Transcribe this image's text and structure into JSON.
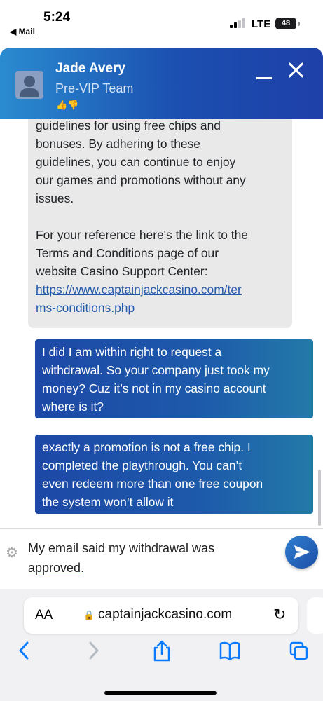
{
  "status_bar": {
    "time": "5:24",
    "back_label": "◀ Mail",
    "network": "LTE",
    "battery": "48"
  },
  "chat_header": {
    "agent_name": "Jade Avery",
    "agent_team": "Pre-VIP Team",
    "rating_icons": "👍👎"
  },
  "messages": {
    "agent": {
      "lines": [
        "guidelines for using free chips and",
        "bonuses. By adhering to these",
        "guidelines, you can continue to enjoy",
        "our games and promotions without any",
        "issues.",
        "",
        "For your reference here's the link to the",
        "Terms and Conditions page of our",
        "website Casino Support Center:"
      ],
      "link_line_1": "https://www.captainjackcasino.com/ter",
      "link_line_2": "ms-conditions.php"
    },
    "user_1": {
      "lines": [
        "I did I am within right to request a",
        "withdrawal. So your company just took my",
        "money? Cuz it’s not in my casino account",
        "where is it?"
      ]
    },
    "user_2": {
      "lines": [
        "exactly a promotion is not a free chip. I",
        "completed the playthrough. You can’t",
        "even redeem more than one free coupon",
        "the system won’t allow it"
      ]
    }
  },
  "composer": {
    "text_line_1": "My email said my withdrawal was",
    "text_line_2_underlined": "approved",
    "text_line_2_tail": "."
  },
  "browser": {
    "aa_label": "AA",
    "url": "captainjackcasino.com"
  },
  "colors": {
    "header_start": "#2a8bd0",
    "header_end": "#1e40a8",
    "user_bubble": "#1d48a6",
    "agent_bubble": "#e9e9ea",
    "link": "#2458a8",
    "ios_blue": "#0a7aff"
  }
}
